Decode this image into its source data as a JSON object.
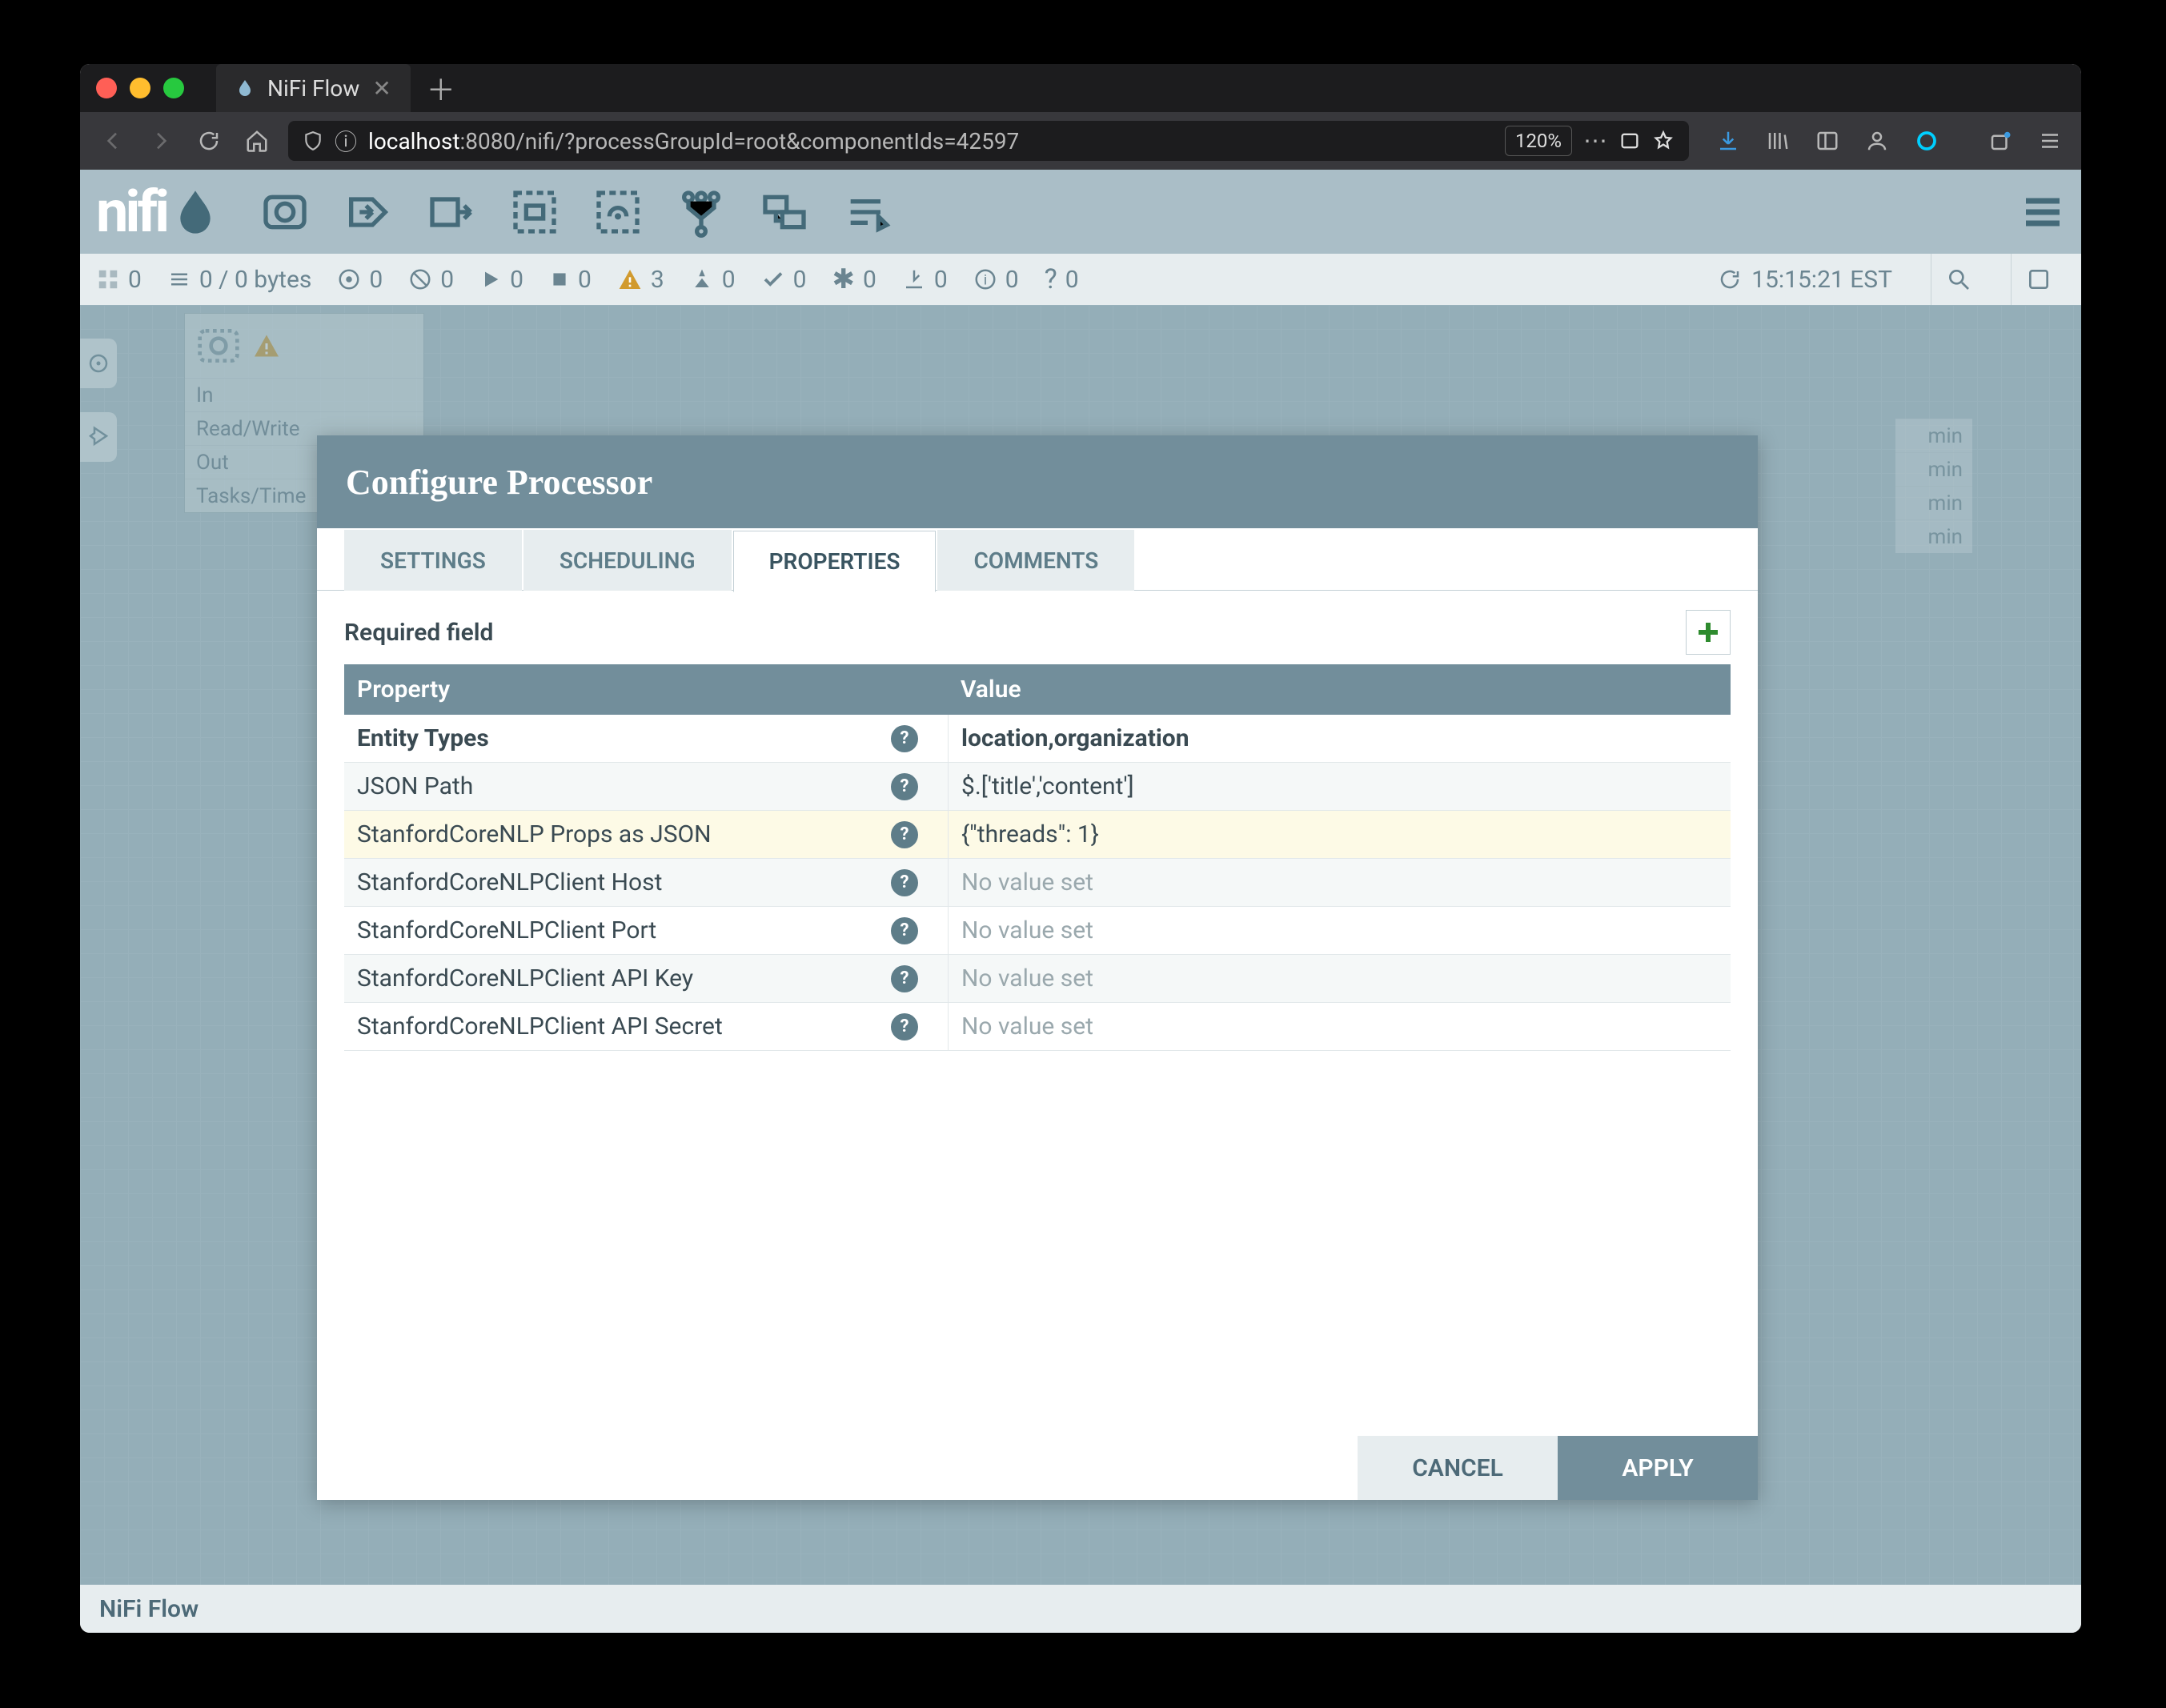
{
  "browser": {
    "tab_title": "NiFi Flow",
    "url_host": "localhost",
    "url_path": ":8080/nifi/?processGroupId=root&componentIds=42597",
    "zoom": "120%"
  },
  "header": {
    "logo_text": "nifi"
  },
  "status": {
    "components": "0",
    "queued": "0 / 0 bytes",
    "transmitting": "0",
    "not_transmitting": "0",
    "running": "0",
    "stopped": "0",
    "invalid": "3",
    "disabled": "0",
    "uptodate": "0",
    "locally_modified": "0",
    "stale": "0",
    "sync_failure": "0",
    "unknown": "0",
    "refresh_time": "15:15:21 EST"
  },
  "footer": {
    "breadcrumb": "NiFi Flow"
  },
  "processor_card": {
    "in_label": "In",
    "rw_label": "Read/Write",
    "out_label": "Out",
    "tasks_label": "Tasks/Time",
    "right_suffix": "min"
  },
  "modal": {
    "title": "Configure Processor",
    "tabs": [
      "SETTINGS",
      "SCHEDULING",
      "PROPERTIES",
      "COMMENTS"
    ],
    "active_tab": "PROPERTIES",
    "required_label": "Required field",
    "col_property": "Property",
    "col_value": "Value",
    "no_value": "No value set",
    "cancel": "CANCEL",
    "apply": "APPLY",
    "rows": [
      {
        "name": "Entity Types",
        "value": "location,organization",
        "bold": true
      },
      {
        "name": "JSON Path",
        "value": "$.['title','content']"
      },
      {
        "name": "StanfordCoreNLP Props as JSON",
        "value": "{\"threads\": 1}",
        "hl": true
      },
      {
        "name": "StanfordCoreNLPClient Host",
        "value": null
      },
      {
        "name": "StanfordCoreNLPClient Port",
        "value": null
      },
      {
        "name": "StanfordCoreNLPClient API Key",
        "value": null
      },
      {
        "name": "StanfordCoreNLPClient API Secret",
        "value": null
      }
    ]
  }
}
